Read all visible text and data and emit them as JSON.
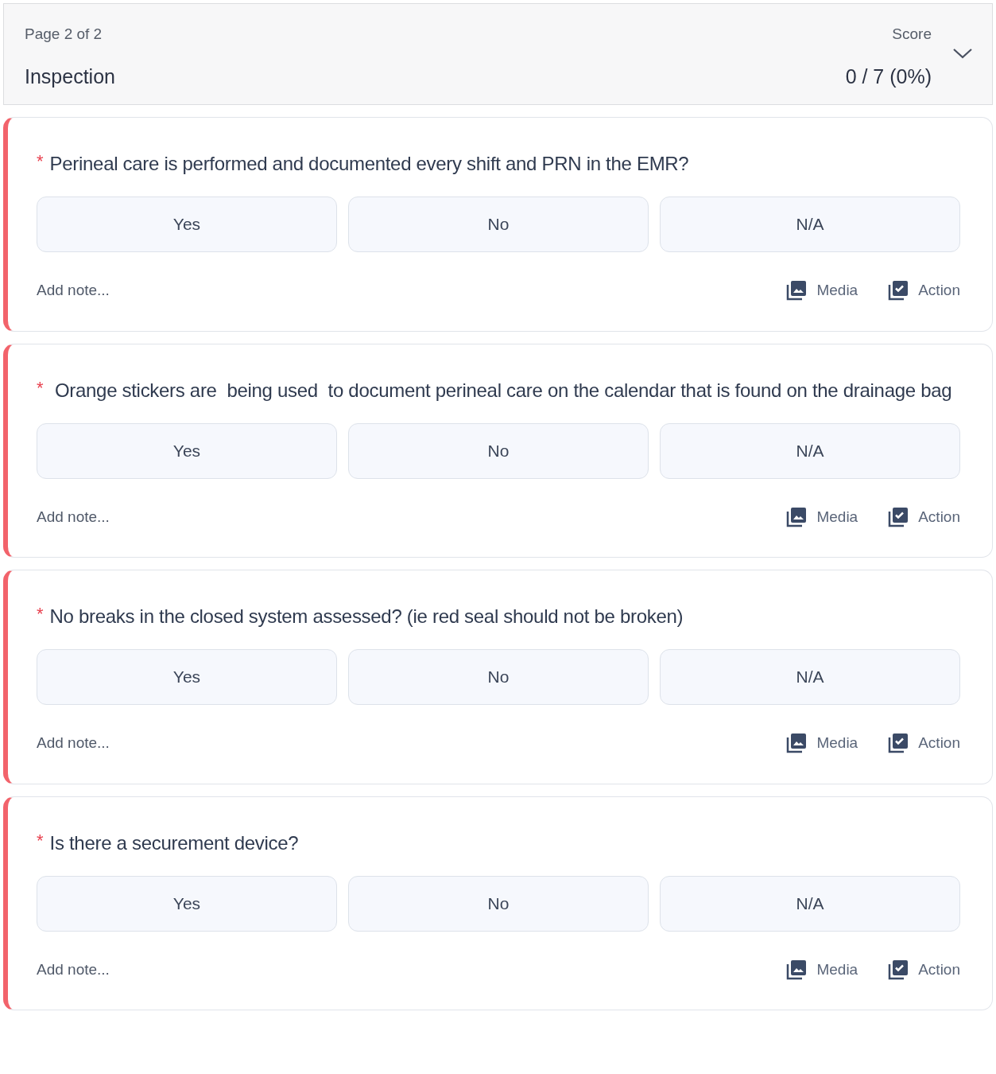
{
  "header": {
    "page": "Page 2 of 2",
    "title": "Inspection",
    "score_label": "Score",
    "score": "0 / 7 (0%)",
    "expanded": true
  },
  "questions": [
    {
      "mark": "*",
      "required": true,
      "text": "Perineal care is performed and documented every shift and PRN in the EMR?",
      "options": [
        {
          "label": "Yes",
          "selected": false
        },
        {
          "label": "No",
          "selected": false
        },
        {
          "label": "N/A",
          "selected": false
        }
      ],
      "note": "Add note...",
      "media": "Media",
      "action": "Action"
    },
    {
      "mark": "*",
      "required": true,
      "text": " Orange stickers are  being used  to document perineal care on the calendar that is found on the drainage bag",
      "options": [
        {
          "label": "Yes",
          "selected": false
        },
        {
          "label": "No",
          "selected": false
        },
        {
          "label": "N/A",
          "selected": false
        }
      ],
      "note": "Add note...",
      "media": "Media",
      "action": "Action"
    },
    {
      "mark": "*",
      "required": true,
      "text": "No breaks in the closed system assessed? (ie red seal should not be broken)",
      "options": [
        {
          "label": "Yes",
          "selected": false
        },
        {
          "label": "No",
          "selected": false
        },
        {
          "label": "N/A",
          "selected": false
        }
      ],
      "note": "Add note...",
      "media": "Media",
      "action": "Action"
    },
    {
      "mark": "*",
      "required": true,
      "text": "Is there a securement device?",
      "options": [
        {
          "label": "Yes",
          "selected": false
        },
        {
          "label": "No",
          "selected": false
        },
        {
          "label": "N/A",
          "selected": false
        }
      ],
      "note": "Add note...",
      "media": "Media",
      "action": "Action"
    }
  ]
}
